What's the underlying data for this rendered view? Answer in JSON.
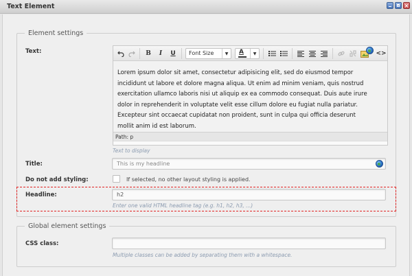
{
  "window": {
    "title": "Text Element"
  },
  "element_settings": {
    "legend": "Element settings",
    "text_label": "Text:",
    "editor": {
      "font_size_label": "Font Size",
      "color_label": "A",
      "bold": "B",
      "italic": "I",
      "underline": "U",
      "content_lines": [
        "Lorem ipsum dolor sit amet, consectetur adipisicing elit, sed do eiusmod tempor",
        "incididunt ut labore et dolore magna aliqua. Ut enim ad minim veniam, quis nostrud",
        "exercitation ullamco laboris nisi ut aliquip ex ea commodo consequat. Duis aute irure",
        "dolor in reprehenderit in voluptate velit esse cillum dolore eu fugiat nulla pariatur.",
        "Excepteur sint occaecat cupidatat non proident, sunt in culpa qui officia deserunt",
        "mollit anim id est laborum."
      ],
      "path": "Path: p"
    },
    "text_hint": "Text to display",
    "title_label": "Title:",
    "title_placeholder": "This is my headline",
    "no_styling_label": "Do not add styling:",
    "no_styling_text": "If selected, no other layout styling is applied.",
    "headline_label": "Headline:",
    "headline_value": "h2",
    "headline_hint": "Enter one valid HTML headline tag (e.g. h1, h2, h3, ...)"
  },
  "global_settings": {
    "legend": "Global element settings",
    "css_label": "CSS class:",
    "css_value": "",
    "css_hint": "Multiple classes can be added by separating them with a whitespace."
  },
  "icons": {
    "undo": "undo-icon",
    "redo": "redo-icon",
    "bullet_list": "bullet-list-icon",
    "numbered_list": "numbered-list-icon",
    "align_left": "align-left-icon",
    "align_center": "align-center-icon",
    "align_right": "align-right-icon",
    "link": "link-icon",
    "unlink": "unlink-icon",
    "image": "image-icon",
    "source": "source-code-icon",
    "translate": "globe-icon"
  },
  "colors": {
    "highlight_border": "#e02020",
    "hint_text": "#8b9bb0",
    "window_button": "#4a74b8",
    "close_button": "#c24848"
  }
}
